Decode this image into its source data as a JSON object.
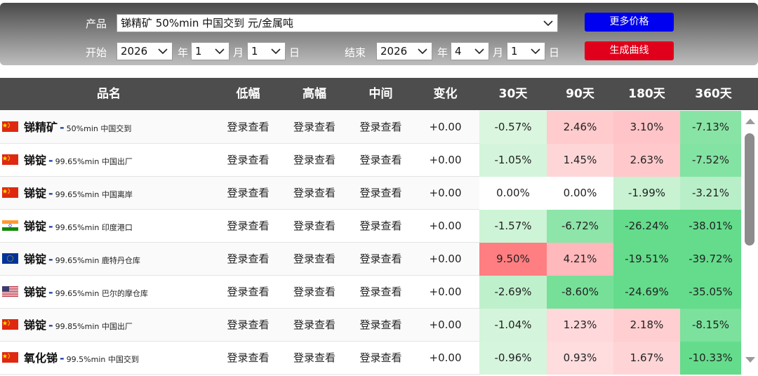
{
  "filter": {
    "product_label": "产品",
    "product_value": "锑精矿 50%min 中国交到 元/金属吨",
    "start_label": "开始",
    "end_label": "结束",
    "start": {
      "year": "2026",
      "month": "1",
      "day": "1"
    },
    "end": {
      "year": "2026",
      "month": "4",
      "day": "1"
    },
    "year_unit": "年",
    "month_unit": "月",
    "day_unit": "日",
    "more_prices_button": "更多价格",
    "generate_chart_button": "生成曲线"
  },
  "table": {
    "headers": [
      "品名",
      "低幅",
      "高幅",
      "中间",
      "变化",
      "30天",
      "90天",
      "180天",
      "360天"
    ],
    "login_text": "登录查看",
    "rows": [
      {
        "flag": "cn",
        "name": "锑精矿",
        "spec": "50%min 中国交到",
        "change": "+0.00",
        "d30": "-0.57%",
        "d90": "2.46%",
        "d180": "3.10%",
        "d360": "-7.13%"
      },
      {
        "flag": "cn",
        "name": "锑锭",
        "spec": "99.65%min 中国出厂",
        "change": "+0.00",
        "d30": "-1.05%",
        "d90": "1.45%",
        "d180": "2.63%",
        "d360": "-7.52%"
      },
      {
        "flag": "cn",
        "name": "锑锭",
        "spec": "99.65%min 中国离岸",
        "change": "+0.00",
        "d30": "0.00%",
        "d90": "0.00%",
        "d180": "-1.99%",
        "d360": "-3.21%"
      },
      {
        "flag": "in",
        "name": "锑锭",
        "spec": "99.65%min 印度港口",
        "change": "+0.00",
        "d30": "-1.57%",
        "d90": "-6.72%",
        "d180": "-26.24%",
        "d360": "-38.01%"
      },
      {
        "flag": "eu",
        "name": "锑锭",
        "spec": "99.65%min 鹿特丹仓库",
        "change": "+0.00",
        "d30": "9.50%",
        "d90": "4.21%",
        "d180": "-19.51%",
        "d360": "-39.72%"
      },
      {
        "flag": "us",
        "name": "锑锭",
        "spec": "99.65%min 巴尔的摩仓库",
        "change": "+0.00",
        "d30": "-2.69%",
        "d90": "-8.60%",
        "d180": "-24.69%",
        "d360": "-35.05%"
      },
      {
        "flag": "cn",
        "name": "锑锭",
        "spec": "99.85%min 中国出厂",
        "change": "+0.00",
        "d30": "-1.04%",
        "d90": "1.23%",
        "d180": "2.18%",
        "d360": "-8.15%"
      },
      {
        "flag": "cn",
        "name": "氧化锑",
        "spec": "99.5%min 中国交到",
        "change": "+0.00",
        "d30": "-0.96%",
        "d90": "0.93%",
        "d180": "1.67%",
        "d360": "-10.33%"
      }
    ]
  },
  "colors": {
    "accent_blue": "#0000f0",
    "accent_red": "#e0001b",
    "header_bg": "#4d4d4d",
    "positive_strong": "#e9777d",
    "negative_strong": "#66d888"
  }
}
